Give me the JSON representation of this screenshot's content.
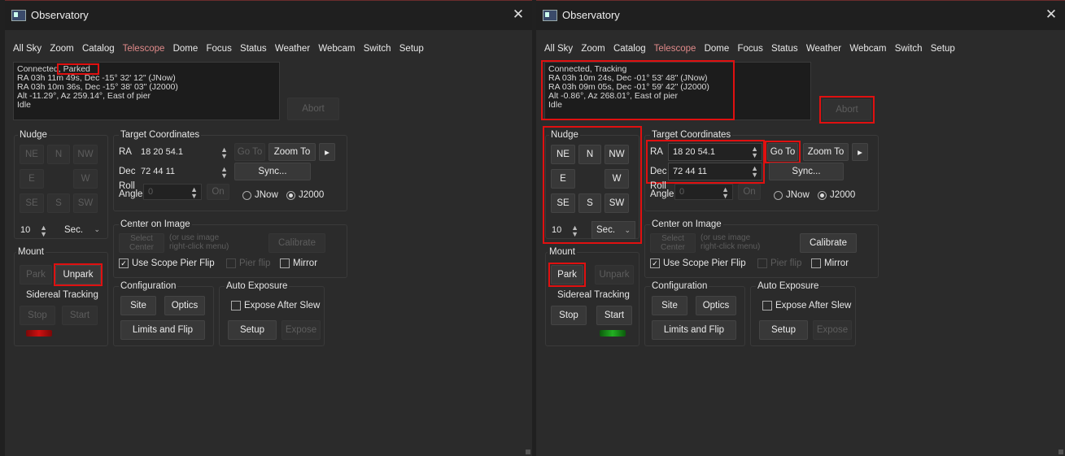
{
  "colors": {
    "highlight": "#e01010",
    "accent_tab": "#e08a8a",
    "led_red": "#c81010",
    "led_green": "#1ea01e"
  },
  "left": {
    "title": "Observatory",
    "close": "✕",
    "tabs": [
      "All Sky",
      "Zoom",
      "Catalog",
      "Telescope",
      "Dome",
      "Focus",
      "Status",
      "Weather",
      "Webcam",
      "Switch",
      "Setup"
    ],
    "active_tab": "Telescope",
    "status_prefix": "Connected, ",
    "status_state": "Parked",
    "status_lines": [
      "RA 03h 11m 49s, Dec -15° 32' 12\" (JNow)",
      "RA 03h 10m 36s, Dec -15° 38' 03\" (J2000)",
      "Alt -11.29°, Az 259.14°, East of pier",
      "Idle"
    ],
    "abort": "Abort",
    "nudge": {
      "label": "Nudge",
      "buttons": [
        "NE",
        "N",
        "NW",
        "E",
        "W",
        "SE",
        "S",
        "SW"
      ],
      "step": "10",
      "unit": "Sec."
    },
    "target": {
      "label": "Target Coordinates",
      "ra_label": "RA",
      "ra_value": "18 20 54.1",
      "dec_label": "Dec",
      "dec_value": "72 44 11",
      "roll_label_1": "Roll",
      "roll_label_2": "Angle",
      "roll_value": "0",
      "on": "On",
      "goto": "Go To",
      "zoomto": "Zoom To",
      "more": "▸",
      "sync": "Sync...",
      "jnow": "JNow",
      "j2000": "J2000"
    },
    "center": {
      "label": "Center on Image",
      "select": "Select Center",
      "hint_1": "(or use image",
      "hint_2": "right-click menu)",
      "calibrate": "Calibrate",
      "use_pier_flip": "Use Scope Pier Flip",
      "pier_flip": "Pier flip",
      "mirror": "Mirror"
    },
    "mount": {
      "label": "Mount",
      "park": "Park",
      "unpark": "Unpark"
    },
    "tracking": {
      "label": "Sidereal Tracking",
      "stop": "Stop",
      "start": "Start",
      "led_state": "red"
    },
    "config": {
      "label": "Configuration",
      "site": "Site",
      "optics": "Optics",
      "limits": "Limits and Flip"
    },
    "autoexp": {
      "label": "Auto Exposure",
      "expose_after": "Expose After Slew",
      "setup": "Setup",
      "expose": "Expose"
    }
  },
  "right": {
    "title": "Observatory",
    "close": "✕",
    "tabs": [
      "All Sky",
      "Zoom",
      "Catalog",
      "Telescope",
      "Dome",
      "Focus",
      "Status",
      "Weather",
      "Webcam",
      "Switch",
      "Setup"
    ],
    "active_tab": "Telescope",
    "status_prefix": "Connected, ",
    "status_state": "Tracking",
    "status_lines": [
      "RA 03h 10m 24s, Dec -01° 53' 48\" (JNow)",
      "RA 03h 09m 05s, Dec -01° 59' 42\" (J2000)",
      "Alt -0.86°, Az 268.01°, East of pier",
      "Idle"
    ],
    "abort": "Abort",
    "nudge": {
      "label": "Nudge",
      "buttons": [
        "NE",
        "N",
        "NW",
        "E",
        "W",
        "SE",
        "S",
        "SW"
      ],
      "step": "10",
      "unit": "Sec."
    },
    "target": {
      "label": "Target Coordinates",
      "ra_label": "RA",
      "ra_value": "18 20 54.1",
      "dec_label": "Dec",
      "dec_value": "72 44 11",
      "roll_label_1": "Roll",
      "roll_label_2": "Angle",
      "roll_value": "0",
      "on": "On",
      "goto": "Go To",
      "zoomto": "Zoom To",
      "more": "▸",
      "sync": "Sync...",
      "jnow": "JNow",
      "j2000": "J2000"
    },
    "center": {
      "label": "Center on Image",
      "select": "Select Center",
      "hint_1": "(or use image",
      "hint_2": "right-click menu)",
      "calibrate": "Calibrate",
      "use_pier_flip": "Use Scope Pier Flip",
      "pier_flip": "Pier flip",
      "mirror": "Mirror"
    },
    "mount": {
      "label": "Mount",
      "park": "Park",
      "unpark": "Unpark"
    },
    "tracking": {
      "label": "Sidereal Tracking",
      "stop": "Stop",
      "start": "Start",
      "led_state": "green"
    },
    "config": {
      "label": "Configuration",
      "site": "Site",
      "optics": "Optics",
      "limits": "Limits and Flip"
    },
    "autoexp": {
      "label": "Auto Exposure",
      "expose_after": "Expose After Slew",
      "setup": "Setup",
      "expose": "Expose"
    }
  }
}
